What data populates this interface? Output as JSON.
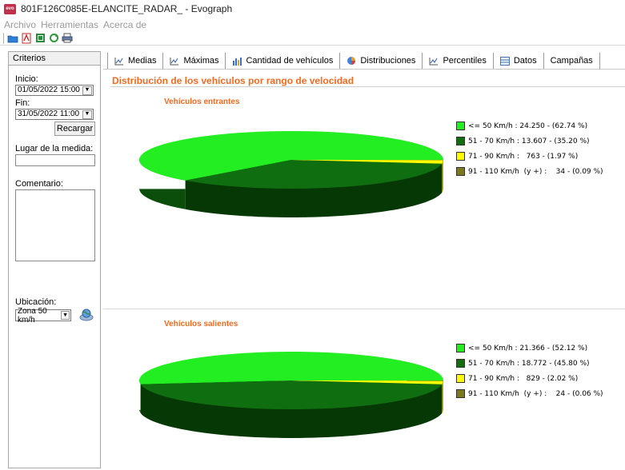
{
  "window": {
    "title": "801F126C085E-ELANCITE_RADAR_ - Evograph",
    "app_icon_text": "evo"
  },
  "menu": [
    {
      "label": "Archivo"
    },
    {
      "label": "Herramientas"
    },
    {
      "label": "Acerca de"
    }
  ],
  "toolbar": {
    "icons": [
      "open-folder-icon",
      "pdf-icon",
      "excel-icon",
      "refresh-icon",
      "print-icon"
    ]
  },
  "criteria": {
    "header": "Criterios",
    "start_label": "Inicio:",
    "start_value": "01/05/2022 15:00",
    "end_label": "Fin:",
    "end_value": "31/05/2022 11:00",
    "reload_label": "Recargar",
    "place_label": "Lugar de la medida:",
    "place_value": "",
    "comment_label": "Comentario:",
    "comment_value": "",
    "location_label": "Ubicación:",
    "location_value": "Zona 50 km/h"
  },
  "tabs": [
    {
      "label": "Medias",
      "icon": "line-chart-icon"
    },
    {
      "label": "Máximas",
      "icon": "line-chart-icon"
    },
    {
      "label": "Cantidad de vehículos",
      "icon": "bar-chart-icon"
    },
    {
      "label": "Distribuciones",
      "icon": "pie-chart-icon",
      "active": true
    },
    {
      "label": "Percentiles",
      "icon": "line-chart-icon"
    },
    {
      "label": "Datos",
      "icon": "table-icon"
    },
    {
      "label": "Campañas",
      "icon": ""
    }
  ],
  "section_title": "Distribución de los vehículos por rango de velocidad",
  "colors": {
    "accent": "#f26a21",
    "c1": "#22ee22",
    "c2": "#0f6e0f",
    "c3": "#ffff00",
    "c4": "#7a7a1a"
  },
  "chart_data": [
    {
      "type": "pie",
      "title": "Vehículos entrantes",
      "categories": [
        "<= 50 Km/h",
        "51 - 70 Km/h",
        "71 - 90 Km/h",
        "91 - 110 Km/h (y +)"
      ],
      "values": [
        24250,
        13607,
        763,
        34
      ],
      "percents": [
        62.74,
        35.2,
        1.97,
        0.09
      ],
      "legend": [
        "<= 50 Km/h : 24.250 - (62.74 %)",
        "51 - 70 Km/h : 13.607 - (35.20 %)",
        "71 - 90 Km/h :   763 - (1.97 %)",
        "91 - 110 Km/h  (y +) :    34 - (0.09 %)"
      ],
      "legend_placement": "right"
    },
    {
      "type": "pie",
      "title": "Vehículos salientes",
      "categories": [
        "<= 50 Km/h",
        "51 - 70 Km/h",
        "71 - 90 Km/h",
        "91 - 110 Km/h (y +)"
      ],
      "values": [
        21366,
        18772,
        829,
        24
      ],
      "percents": [
        52.12,
        45.8,
        2.02,
        0.06
      ],
      "legend": [
        "<= 50 Km/h : 21.366 - (52.12 %)",
        "51 - 70 Km/h : 18.772 - (45.80 %)",
        "71 - 90 Km/h :   829 - (2.02 %)",
        "91 - 110 Km/h  (y +) :    24 - (0.06 %)"
      ],
      "legend_placement": "right"
    }
  ]
}
